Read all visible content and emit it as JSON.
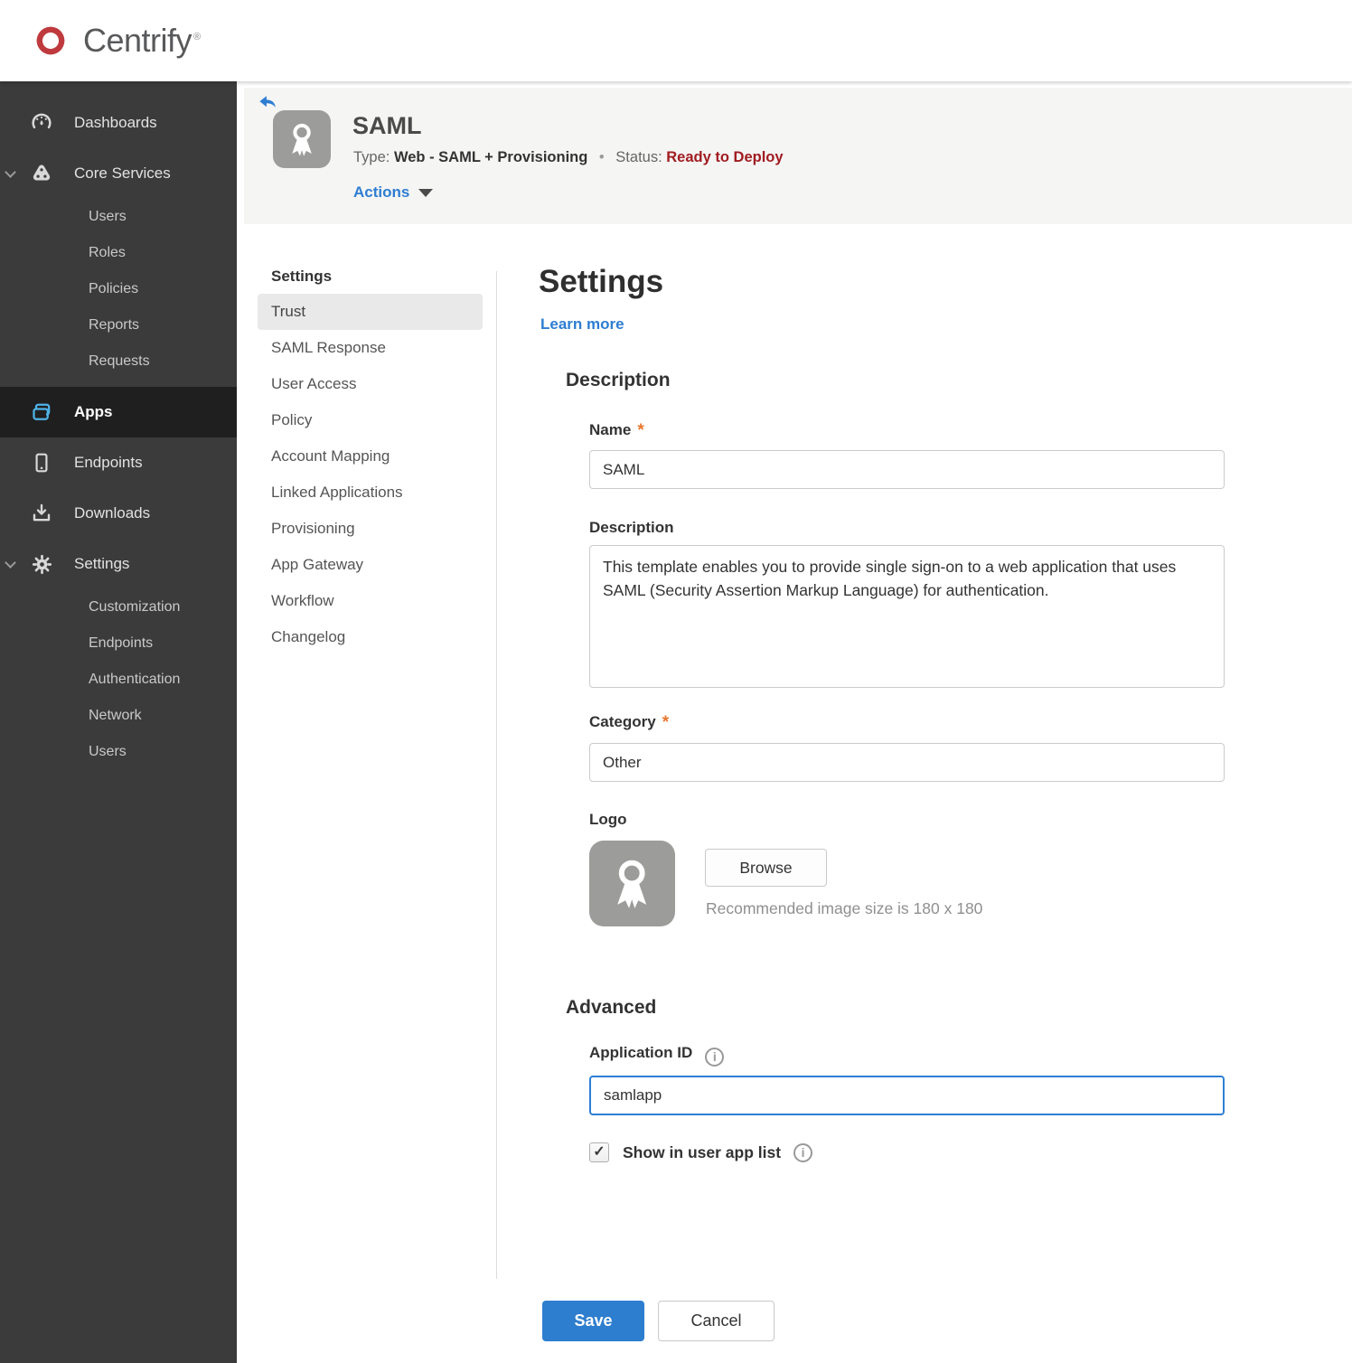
{
  "brand": {
    "name": "Centrify"
  },
  "sidebar": {
    "selected": "Apps",
    "items": [
      {
        "label": "Dashboards"
      },
      {
        "label": "Core Services",
        "expanded": true,
        "children": [
          "Users",
          "Roles",
          "Policies",
          "Reports",
          "Requests"
        ]
      },
      {
        "label": "Apps",
        "selected": true
      },
      {
        "label": "Endpoints"
      },
      {
        "label": "Downloads"
      },
      {
        "label": "Settings",
        "expanded": true,
        "children": [
          "Customization",
          "Endpoints",
          "Authentication",
          "Network",
          "Users"
        ]
      }
    ]
  },
  "header": {
    "title": "SAML",
    "type_label": "Type:",
    "type_value": "Web - SAML + Provisioning",
    "separator": "•",
    "status_label": "Status:",
    "status_value": "Ready to Deploy",
    "actions_label": "Actions"
  },
  "subnav": {
    "header": "Settings",
    "selected": "Trust",
    "items": [
      {
        "label": "Trust"
      },
      {
        "label": "SAML Response"
      },
      {
        "label": "User Access"
      },
      {
        "label": "Policy"
      },
      {
        "label": "Account Mapping"
      },
      {
        "label": "Linked Applications"
      },
      {
        "label": "Provisioning"
      },
      {
        "label": "App Gateway"
      },
      {
        "label": "Workflow"
      },
      {
        "label": "Changelog"
      }
    ]
  },
  "main": {
    "heading": "Settings",
    "learn_more": "Learn more",
    "description_section": {
      "heading": "Description",
      "name_label": "Name",
      "name_required": "*",
      "name_value": "SAML",
      "description_label": "Description",
      "description_value": "This template enables you to provide single sign-on to a web application that uses SAML (Security Assertion Markup Language) for authentication.",
      "category_label": "Category",
      "category_required": "*",
      "category_value": "Other",
      "logo_label": "Logo",
      "browse_label": "Browse",
      "logo_hint": "Recommended image size is 180 x 180"
    },
    "advanced_section": {
      "heading": "Advanced",
      "application_id_label": "Application ID",
      "application_id_value": "samlapp",
      "show_in_app_list_label": "Show in user app list",
      "show_in_app_list_checked": true
    },
    "save_label": "Save",
    "cancel_label": "Cancel"
  },
  "colors": {
    "accent_blue": "#2d7dd2",
    "save_blue": "#2e7ecf",
    "status_red": "#a01c20",
    "required_orange": "#e8772e",
    "apps_icon_blue": "#4fb3e8",
    "sidebar_bg": "#3b3b3b",
    "header_band_bg": "#f5f5f4"
  }
}
